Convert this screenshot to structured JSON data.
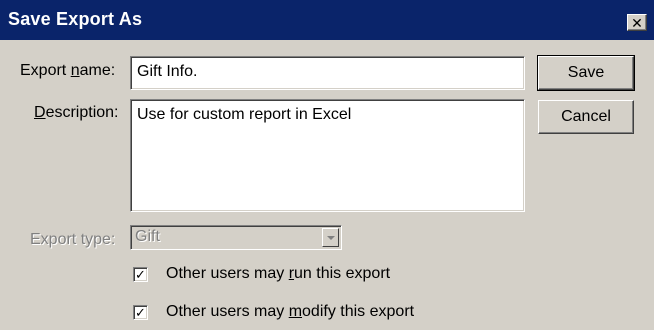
{
  "window": {
    "title": "Save Export As",
    "close_glyph": "✕"
  },
  "form": {
    "export_name": {
      "label_pre": "Export ",
      "label_mnemonic": "n",
      "label_post": "ame:",
      "value": "Gift Info."
    },
    "description": {
      "label_pre": "",
      "label_mnemonic": "D",
      "label_post": "escription:",
      "value": "Use for custom report in Excel"
    },
    "export_type": {
      "label": "Export type:",
      "value": "Gift"
    }
  },
  "options": [
    {
      "pre": "Other users may ",
      "mnemonic": "r",
      "post": "un this export",
      "checked": true
    },
    {
      "pre": "Other users may ",
      "mnemonic": "m",
      "post": "odify this export",
      "checked": true
    }
  ],
  "buttons": {
    "save": "Save",
    "cancel": "Cancel"
  },
  "icons": {
    "close": "close-icon",
    "dropdown": "chevron-down-icon",
    "check": "checkmark-icon"
  },
  "colors": {
    "titlebar": "#0a246a",
    "dialog_face": "#d4d0c8"
  }
}
